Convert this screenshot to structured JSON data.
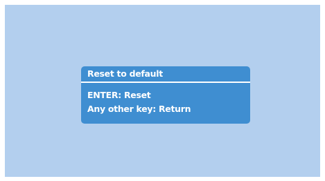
{
  "dialog": {
    "title": "Reset to default",
    "lines": [
      "ENTER: Reset",
      "Any other key: Return"
    ]
  },
  "colors": {
    "screen_background": "#b3cfee",
    "dialog_background": "#3f8ed1",
    "text": "#ffffff"
  }
}
